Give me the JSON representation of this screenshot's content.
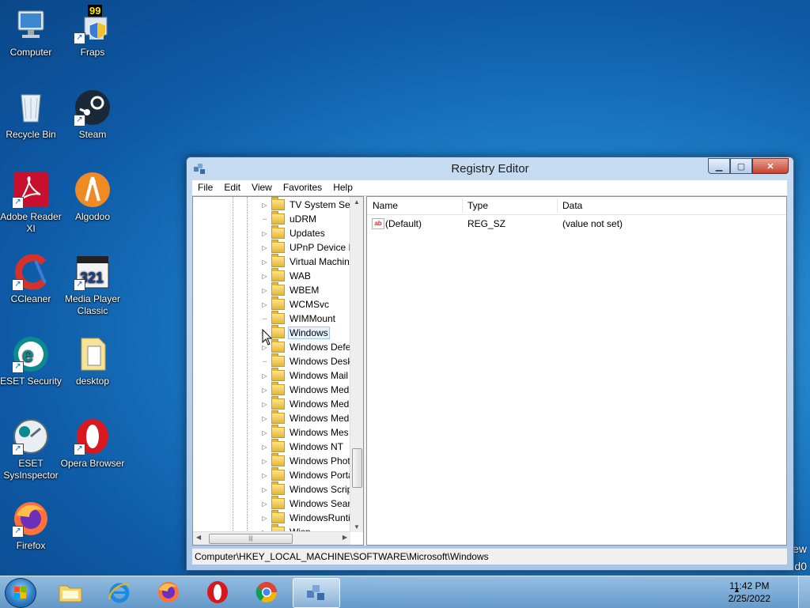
{
  "desktop": {
    "icons": [
      {
        "label": "Computer"
      },
      {
        "label": "Fraps"
      },
      {
        "label": "Recycle Bin"
      },
      {
        "label": "Steam"
      },
      {
        "label": "Adobe Reader XI"
      },
      {
        "label": "Algodoo"
      },
      {
        "label": "CCleaner"
      },
      {
        "label": "Media Player Classic"
      },
      {
        "label": "ESET Security"
      },
      {
        "label": "desktop"
      },
      {
        "label": "ESET SysInspector"
      },
      {
        "label": "Opera Browser"
      },
      {
        "label": "Firefox"
      }
    ],
    "fraps_badge": "99",
    "edge_text_1": "ew",
    "edge_text_2": "d0"
  },
  "window": {
    "title": "Registry Editor",
    "menu": [
      "File",
      "Edit",
      "View",
      "Favorites",
      "Help"
    ],
    "tree": {
      "items": [
        {
          "label": "TV System Ser",
          "expandable": true
        },
        {
          "label": "uDRM",
          "expandable": false
        },
        {
          "label": "Updates",
          "expandable": true
        },
        {
          "label": "UPnP Device H",
          "expandable": true
        },
        {
          "label": "Virtual Machin",
          "expandable": true
        },
        {
          "label": "WAB",
          "expandable": true
        },
        {
          "label": "WBEM",
          "expandable": true
        },
        {
          "label": "WCMSvc",
          "expandable": true
        },
        {
          "label": "WIMMount",
          "expandable": false
        },
        {
          "label": "Windows",
          "expandable": true,
          "selected": true
        },
        {
          "label": "Windows Defe",
          "expandable": true
        },
        {
          "label": "Windows Desk",
          "expandable": false
        },
        {
          "label": "Windows Mail",
          "expandable": true
        },
        {
          "label": "Windows Med",
          "expandable": true
        },
        {
          "label": "Windows Med",
          "expandable": true
        },
        {
          "label": "Windows Med",
          "expandable": true
        },
        {
          "label": "Windows Mes",
          "expandable": true
        },
        {
          "label": "Windows NT",
          "expandable": true
        },
        {
          "label": "Windows Phot",
          "expandable": true
        },
        {
          "label": "Windows Porta",
          "expandable": true
        },
        {
          "label": "Windows Scrip",
          "expandable": true
        },
        {
          "label": "Windows Sear",
          "expandable": true
        },
        {
          "label": "WindowsRunti",
          "expandable": true
        },
        {
          "label": "Wisp",
          "expandable": true
        }
      ]
    },
    "list": {
      "columns": [
        "Name",
        "Type",
        "Data"
      ],
      "rows": [
        {
          "name": "(Default)",
          "type": "REG_SZ",
          "data": "(value not set)"
        }
      ]
    },
    "status_path": "Computer\\HKEY_LOCAL_MACHINE\\SOFTWARE\\Microsoft\\Windows"
  },
  "taskbar": {
    "time": "11:42 PM",
    "date": "2/25/2022",
    "apps": [
      "file-explorer",
      "internet-explorer",
      "firefox",
      "opera",
      "chrome",
      "registry-editor"
    ]
  },
  "colors": {
    "accent": "#1f7fc8",
    "selection": "#e8f3fd",
    "close_button": "#c7432c"
  }
}
